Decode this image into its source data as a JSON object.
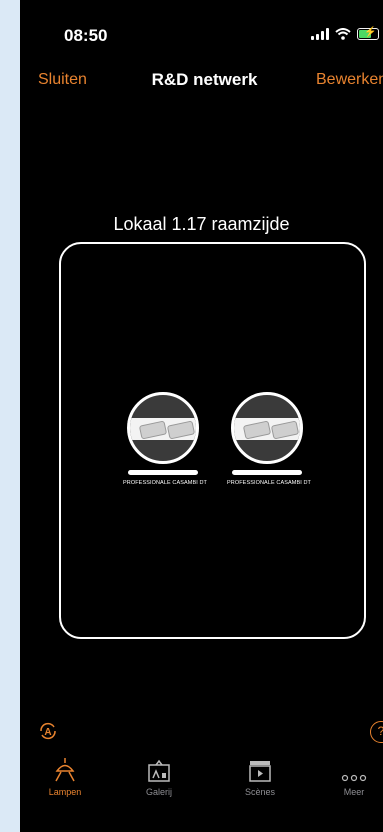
{
  "status": {
    "time": "08:50"
  },
  "nav": {
    "left": "Sluiten",
    "title": "R&D netwerk",
    "right": "Bewerken"
  },
  "room": {
    "title": "Lokaal 1.17 raamzijde",
    "lamps": [
      {
        "label": "PROFESSIONALE CASAMBI DT"
      },
      {
        "label": "PROFESSIONALE CASAMBI DT"
      }
    ]
  },
  "tabs": [
    {
      "label": "Lampen",
      "icon": "lamp-icon"
    },
    {
      "label": "Galerij",
      "icon": "gallery-icon"
    },
    {
      "label": "Scènes",
      "icon": "scenes-icon"
    },
    {
      "label": "Meer",
      "icon": "more-icon"
    }
  ],
  "colors": {
    "accent": "#e8832f",
    "background": "#000000",
    "inactive": "#8e8e93"
  }
}
